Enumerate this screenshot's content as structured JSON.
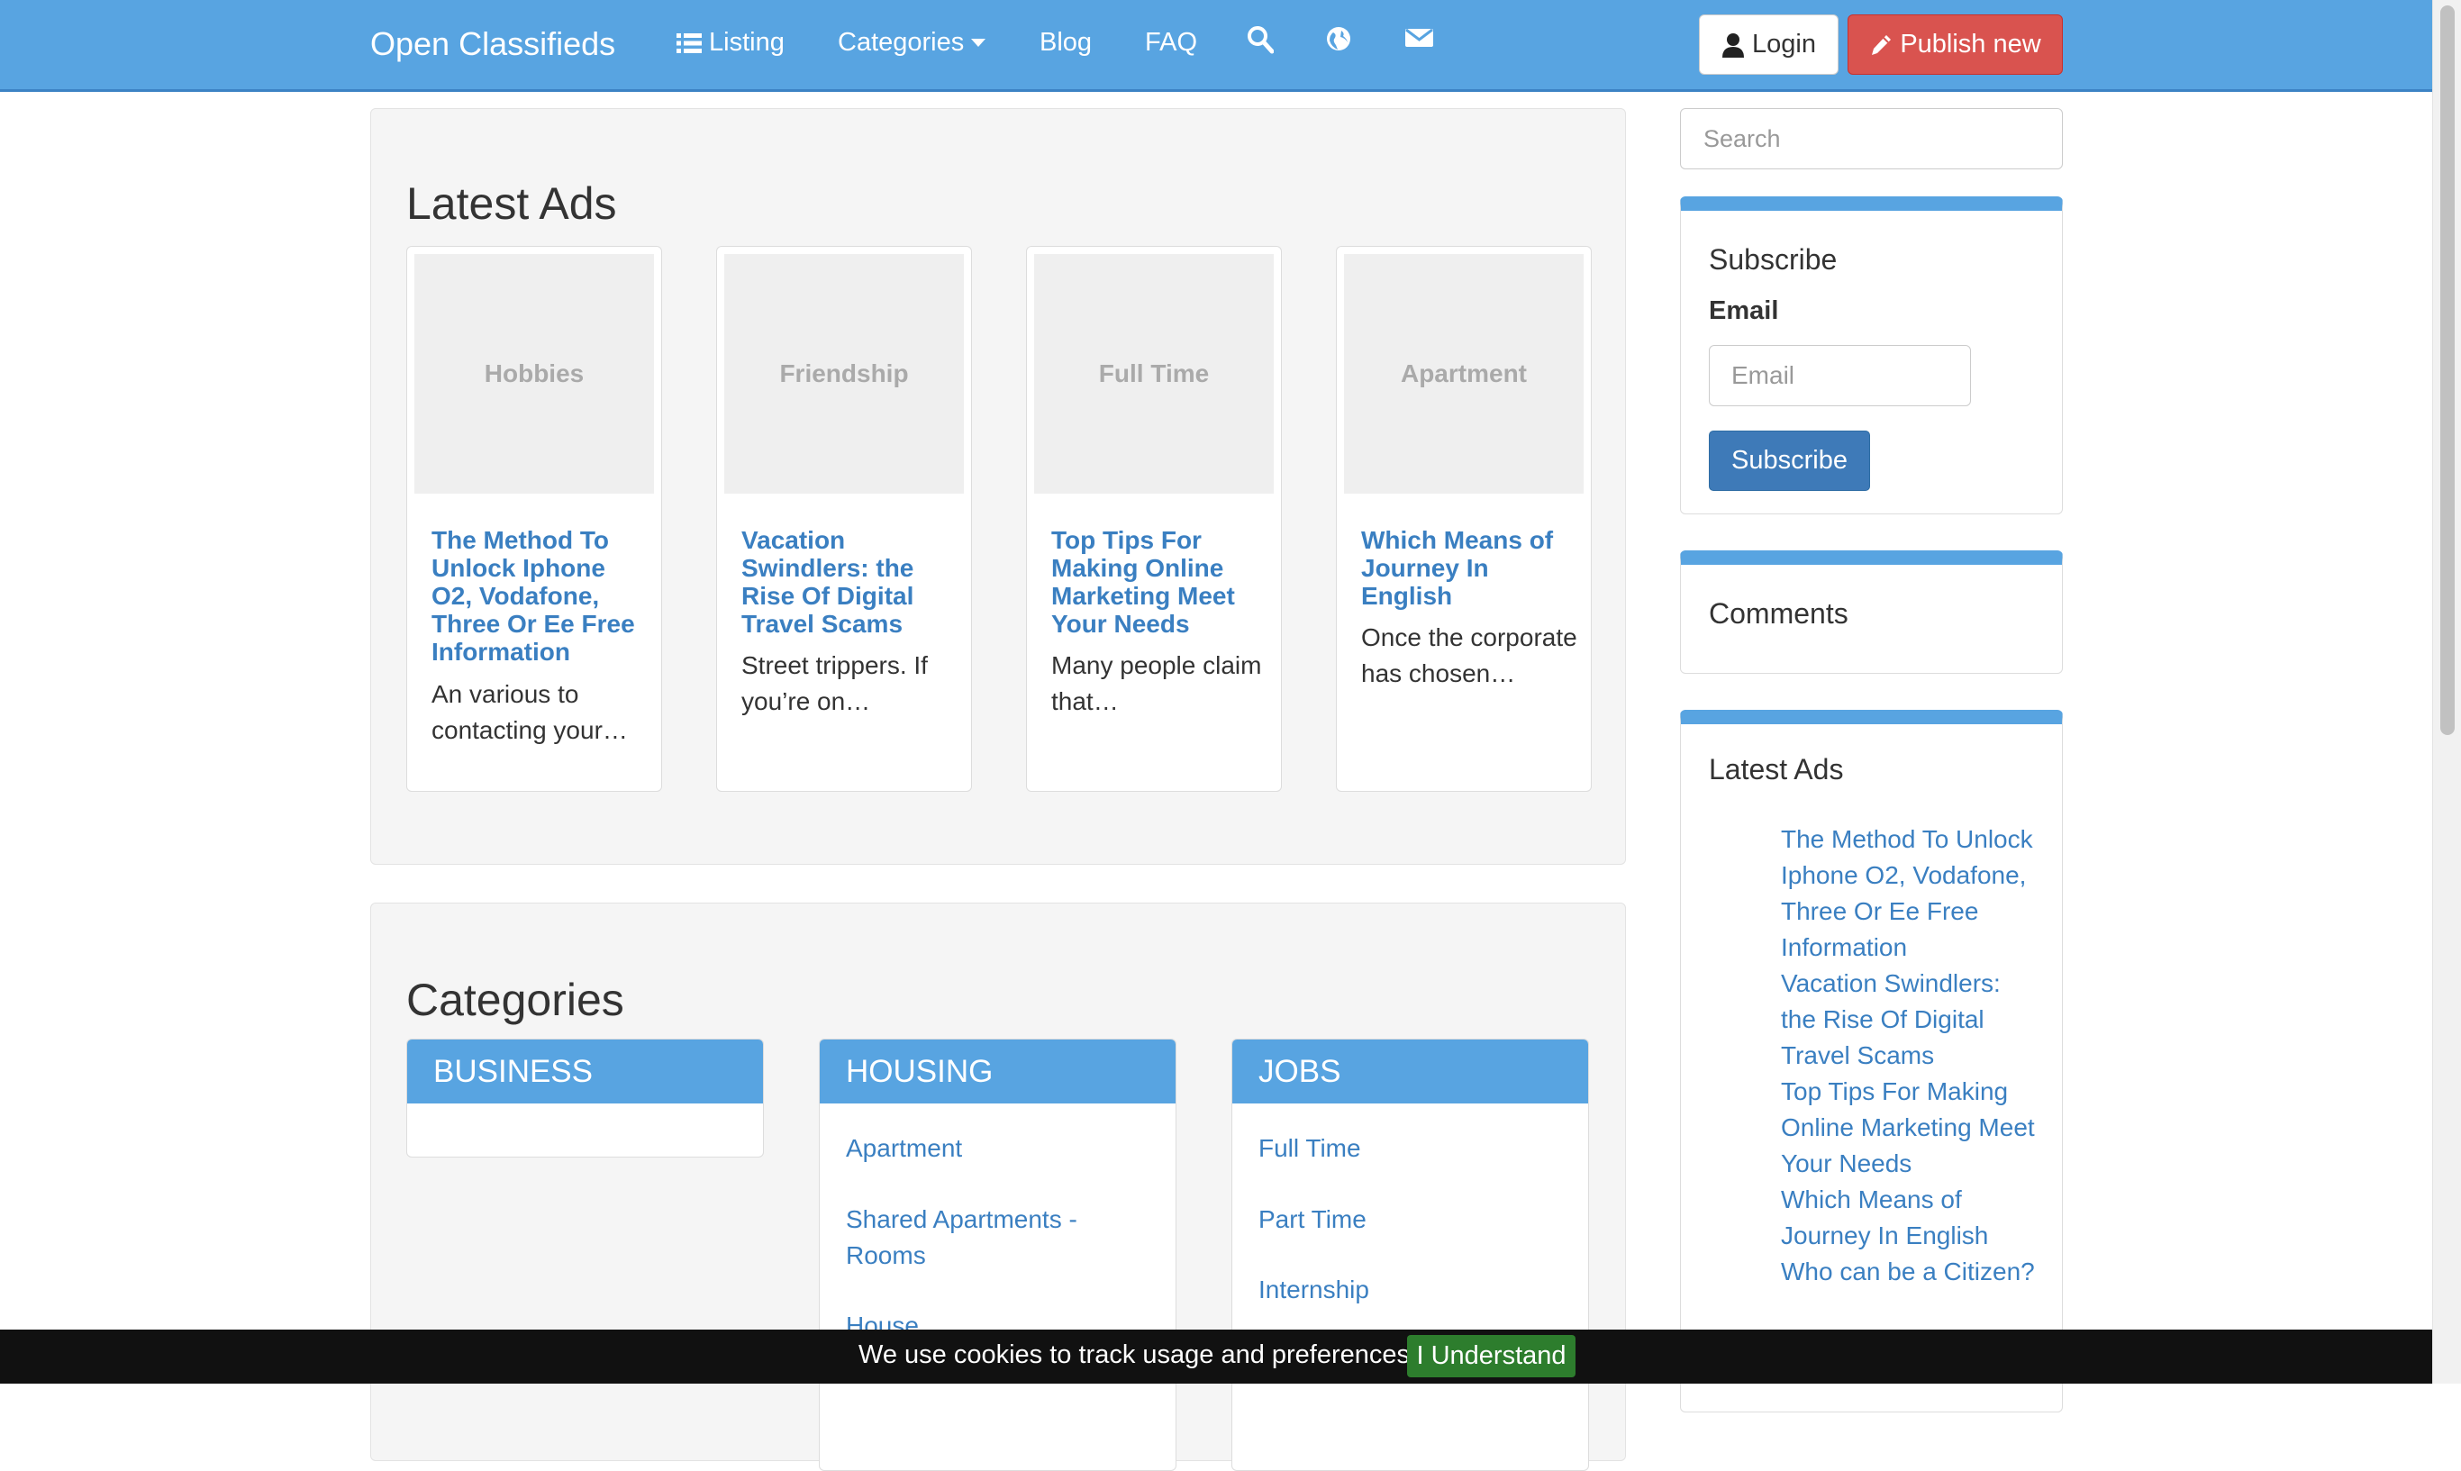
{
  "navbar": {
    "brand": "Open Classifieds",
    "listing": "Listing",
    "categories": "Categories",
    "blog": "Blog",
    "faq": "FAQ",
    "search_icon": "search-icon",
    "globe_icon": "globe-icon",
    "mail_icon": "envelope-icon",
    "login": "Login",
    "publish": "Publish new"
  },
  "latest_ads": {
    "title": "Latest Ads",
    "items": [
      {
        "category": "Hobbies",
        "title": "The Method To Unlock Iphone O2, Vodafone, Three Or Ee Free Information",
        "desc": "An various to contacting your…"
      },
      {
        "category": "Friendship",
        "title": "Vacation Swindlers: the Rise Of Digital Travel Scams",
        "desc": "Street trippers. If you’re on…"
      },
      {
        "category": "Full Time",
        "title": "Top Tips For Making Online Marketing Meet Your Needs",
        "desc": "Many people claim that…"
      },
      {
        "category": "Apartment",
        "title": "Which Means of Journey In English",
        "desc": "Once the corporate has chosen…"
      }
    ]
  },
  "categories": {
    "title": "Categories",
    "groups": [
      {
        "name": "BUSINESS",
        "items": []
      },
      {
        "name": "HOUSING",
        "items": [
          "Apartment",
          "Shared Apartments - Rooms",
          "House"
        ]
      },
      {
        "name": "JOBS",
        "items": [
          "Full Time",
          "Part Time",
          "Internship"
        ]
      }
    ]
  },
  "sidebar": {
    "search_placeholder": "Search",
    "subscribe": {
      "title": "Subscribe",
      "email_label": "Email",
      "email_placeholder": "Email",
      "button": "Subscribe"
    },
    "comments": {
      "title": "Comments"
    },
    "latest_ads": {
      "title": "Latest Ads",
      "links": [
        "The Method To Unlock Iphone O2, Vodafone, Three Or Ee Free Information",
        "Vacation Swindlers: the Rise Of Digital Travel Scams",
        "Top Tips For Making Online Marketing Meet Your Needs",
        "Which Means of Journey In English",
        "Who can be a Citizen?"
      ]
    }
  },
  "cookie_bar": {
    "text": "We use cookies to track usage and preferences",
    "button": "I Understand"
  },
  "colors": {
    "navbar": "#58a4e1",
    "link": "#3a7fc1",
    "publish_button": "#d9534f",
    "subscribe_button": "#3e7ab8",
    "cookie_button": "#2d7d2d"
  }
}
